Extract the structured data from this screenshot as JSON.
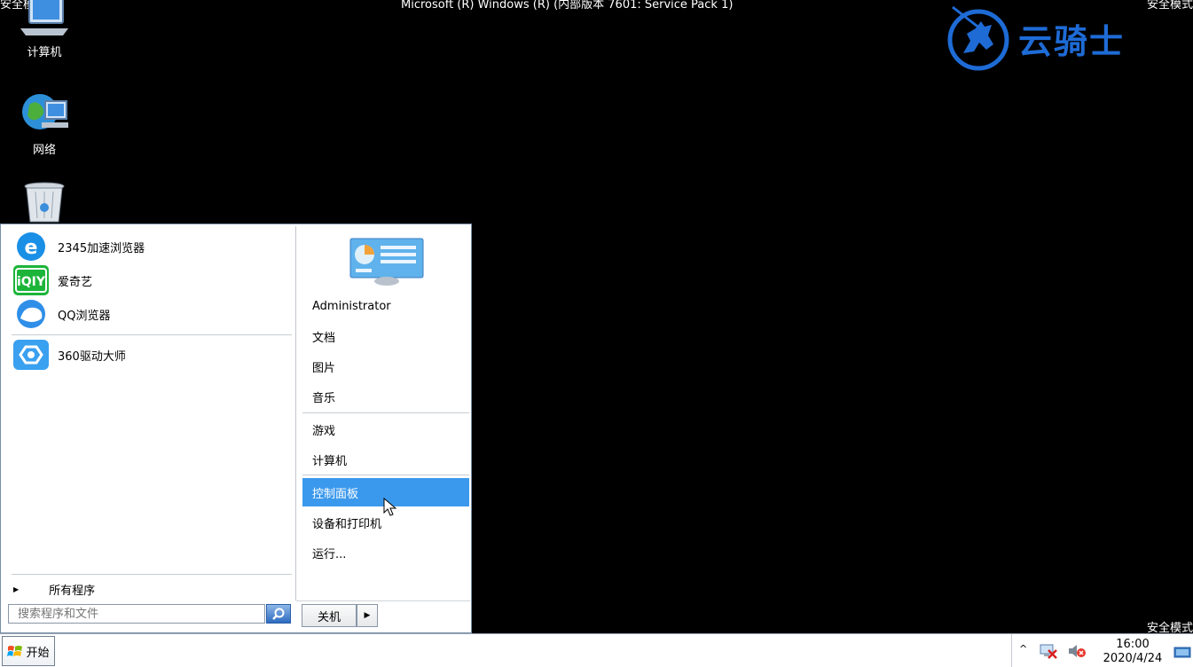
{
  "banners": {
    "safe_mode": "安全模式",
    "os_title": "Microsoft (R) Windows (R) (内部版本 7601: Service Pack 1)"
  },
  "brand": {
    "text": "云骑士"
  },
  "desktop": {
    "icons": [
      {
        "label": "计算机",
        "icon": "computer-icon"
      },
      {
        "label": "网络",
        "icon": "network-globe-icon"
      },
      {
        "label": "",
        "icon": "recycle-bin-icon"
      }
    ]
  },
  "start_menu": {
    "programs": [
      {
        "label": "2345加速浏览器",
        "icon": "2345-browser-icon"
      },
      {
        "label": "爱奇艺",
        "icon": "iqiyi-icon"
      },
      {
        "label": "QQ浏览器",
        "icon": "qq-browser-icon"
      },
      {
        "label": "360驱动大师",
        "icon": "360-driver-icon"
      }
    ],
    "all_programs": "所有程序",
    "search_placeholder": "搜索程序和文件",
    "right_items": [
      "Administrator",
      "文档",
      "图片",
      "音乐",
      "游戏",
      "计算机",
      "控制面板",
      "设备和打印机",
      "运行..."
    ],
    "selected_item": "控制面板",
    "shutdown_label": "关机"
  },
  "taskbar": {
    "start_label": "开始",
    "time": "16:00",
    "date": "2020/4/24"
  },
  "colors": {
    "selection": "#3b99ed",
    "brand": "#1e6bd6",
    "desktop": "#000000"
  }
}
